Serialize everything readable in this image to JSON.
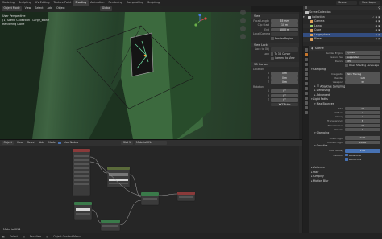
{
  "topbar": {
    "workspaces": [
      "Modeling",
      "Sculpting",
      "UV Editing",
      "Texture Paint",
      "Shading",
      "Animation",
      "Rendering",
      "Compositing",
      "Scripting"
    ],
    "active_workspace": "Shading",
    "scene": "Scene",
    "view_layer": "View Layer"
  },
  "viewport": {
    "mode": "Object Mode",
    "menus": [
      "View",
      "Select",
      "Add",
      "Object"
    ],
    "shading_mode": "Global",
    "info": [
      "User Perspective",
      "(1) Scene Collection | Large_stone",
      "Rendering Done"
    ]
  },
  "npanel": {
    "view_section": "View",
    "focal_label": "Focal Length",
    "focal_value": "35 mm",
    "clip_start_label": "Clip Start",
    "clip_start_value": "10 m",
    "clip_end_label": "End",
    "clip_end_value": "1000 m",
    "local_camera_label": "Local Camera",
    "render_region_label": "Render Region",
    "view_lock_section": "View Lock",
    "lock_obj_label": "Lock to Obj",
    "lock_label": "Lock",
    "to_3d_cursor": "To 3D Cursor",
    "camera_to_view": "Camera to View",
    "cursor_section": "3D Cursor",
    "location_label": "Location",
    "x_label": "X",
    "x_value": "0 m",
    "y_label": "Y",
    "y_value": "0 m",
    "z_label": "Z",
    "z_value": "0 m",
    "rotation_label": "Rotation",
    "rx_value": "0°",
    "ry_value": "0°",
    "rz_value": "0°",
    "mode_value": "XYZ Euler"
  },
  "outliner": {
    "title": "Scene Collection",
    "rows": [
      {
        "label": "Collection",
        "color": "#c8c8c8"
      },
      {
        "label": "Camera",
        "color": "#e0a15a"
      },
      {
        "label": "Lamp",
        "color": "#9fd16b"
      },
      {
        "label": "Cube",
        "color": "#e0a15a"
      },
      {
        "label": "Large_stone",
        "color": "#e0a15a"
      },
      {
        "label": "Plane",
        "color": "#e0a15a"
      }
    ]
  },
  "properties": {
    "scene_name": "Scene",
    "render_engine_label": "Render Engine",
    "render_engine": "Cycles",
    "feature_set_label": "Feature Set",
    "feature_set": "Supported",
    "device_label": "Device",
    "device": "CPU",
    "open_shading_language": "Open Shading Language",
    "sampling_section": "Sampling",
    "integrator_label": "Integrator",
    "integrator": "Path Tracing",
    "render_label": "Render",
    "render_samples": "128",
    "viewport_label": "Viewport",
    "viewport_samples": "32",
    "adaptive_sampling": "Adaptive Sampling",
    "denoising": "Denoising",
    "advanced": "Advanced",
    "light_paths": "Light Paths",
    "max_bounces": "Max Bounces",
    "total_label": "Total",
    "total": "12",
    "diffuse_label": "Diffuse",
    "diffuse": "4",
    "glossy_label": "Glossy",
    "glossy": "4",
    "transparency_label": "Transparency",
    "transparency": "8",
    "transmission_label": "Transmission",
    "transmission": "12",
    "volume_label": "Volume",
    "volume": "0",
    "clamping": "Clamping",
    "direct_light_label": "Direct Light",
    "direct_light": "0.00",
    "indirect_light_label": "Indirect Light",
    "indirect_light": "10.00",
    "caustics": "Caustics",
    "filter_glossy_label": "Filter Glossy",
    "filter_glossy": "1.00",
    "caustics_label": "Caustics",
    "reflective": "Reflective",
    "refractive": "Refractive",
    "collapsed": [
      "Volumes",
      "Hair",
      "Simplify",
      "Motion Blur"
    ]
  },
  "node_editor": {
    "mode": "Object",
    "menus": [
      "View",
      "Select",
      "Add",
      "Node"
    ],
    "use_nodes": "Use Nodes",
    "slot": "Slot 1",
    "material": "Material.014",
    "label": "Material.014"
  },
  "statusbar": {
    "left": "Select",
    "middle": "Pan View",
    "right": "Object Context Menu"
  },
  "colors": {
    "accent": "#4772b3",
    "active_tab": "#c8762a"
  }
}
